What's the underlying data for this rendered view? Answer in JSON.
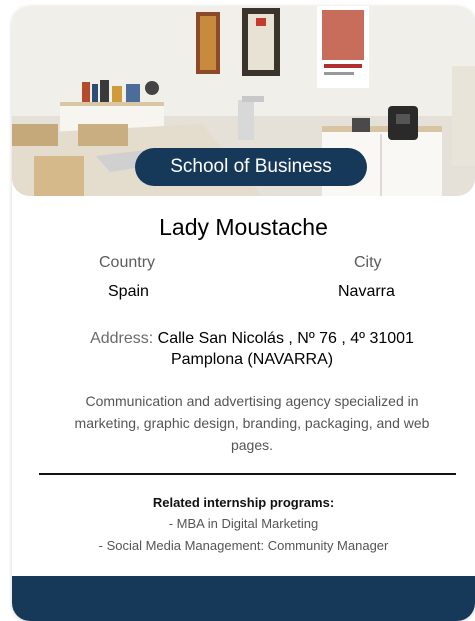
{
  "card": {
    "school_badge": "School of Business",
    "company_name": "Lady Moustache",
    "country_label": "Country",
    "country_value": "Spain",
    "city_label": "City",
    "city_value": "Navarra",
    "address_label": "Address:",
    "address_line1": "Calle San Nicolás , Nº 76 , 4º 31001",
    "address_line2": "Pamplona (NAVARRA)",
    "description": "Communication and advertising agency specialized in marketing, graphic design, branding, packaging, and web pages.",
    "related_title": "Related internship programs:",
    "programs": [
      "- MBA in Digital Marketing",
      "- Social Media Management: Community Manager"
    ]
  },
  "colors": {
    "navy": "#16395a"
  }
}
